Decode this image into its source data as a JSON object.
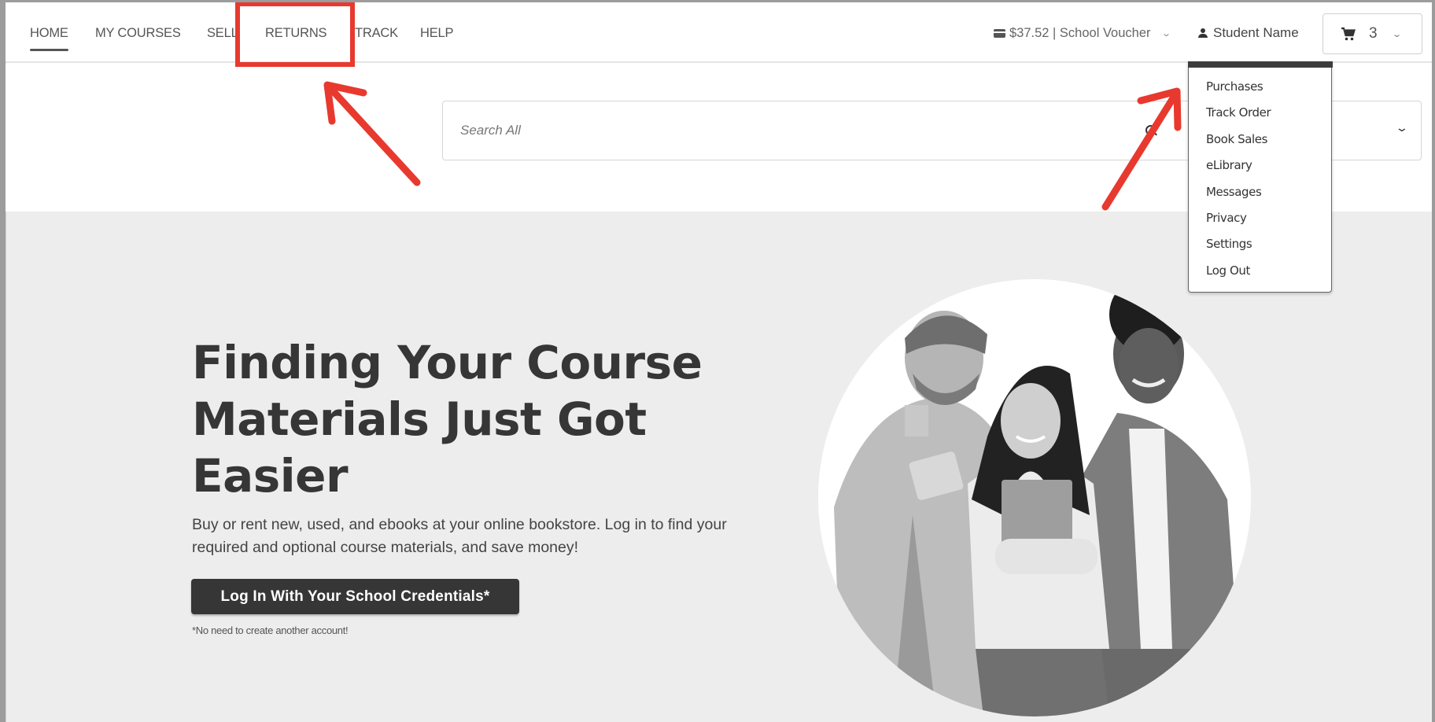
{
  "nav": {
    "items": [
      {
        "label": "HOME",
        "active": true
      },
      {
        "label": "MY COURSES",
        "active": false
      },
      {
        "label": "SELL",
        "active": false
      },
      {
        "label": "RETURNS",
        "active": false
      },
      {
        "label": "TRACK",
        "active": false
      },
      {
        "label": "HELP",
        "active": false
      }
    ]
  },
  "account": {
    "balance": "$37.52 | School Voucher",
    "user_name": "Student Name",
    "cart_count": "3"
  },
  "search": {
    "placeholder": "Search All",
    "value": ""
  },
  "user_menu": {
    "items": [
      "Purchases",
      "Track Order",
      "Book Sales",
      "eLibrary",
      "Messages",
      "Privacy",
      "Settings",
      "Log Out"
    ]
  },
  "hero": {
    "title": "Finding Your Course Materials Just Got Easier",
    "subtitle": "Buy or rent new, used, and ebooks at your online bookstore. Log in to find your required and optional course materials, and save money!",
    "cta_label": "Log In With Your School Credentials*",
    "footnote": "*No need to create another account!",
    "image_alt": "Three smiling students holding books and a tablet"
  },
  "annotations": {
    "highlight_target": "RETURNS",
    "arrow_targets": [
      "RETURNS",
      "Student Name menu"
    ],
    "color": "#e8392f"
  }
}
